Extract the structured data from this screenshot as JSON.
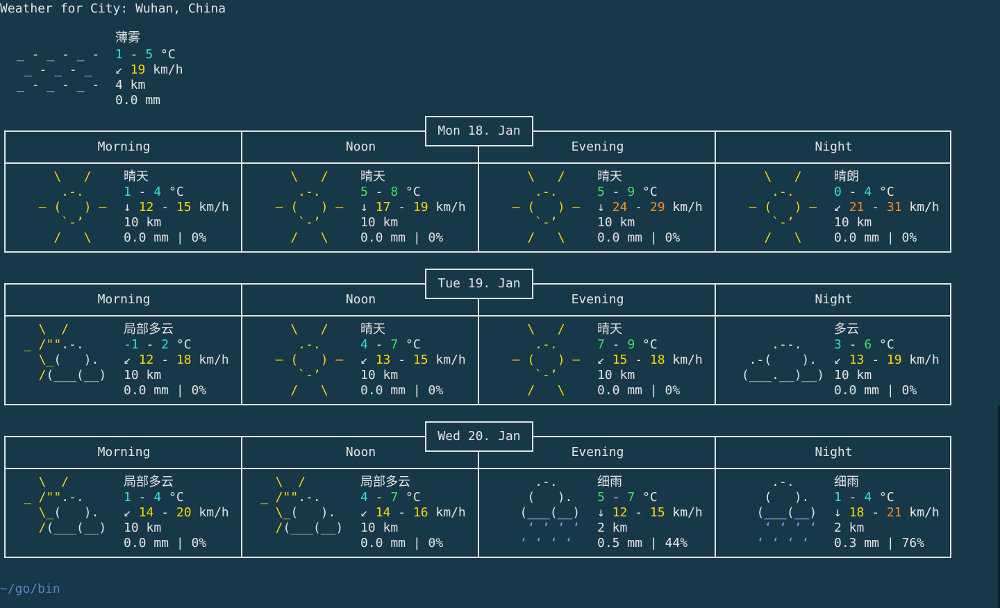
{
  "title": "Weather for City: Wuhan, China",
  "current": {
    "art": [
      "_ - _ - _ -",
      " _ - _ - _",
      "_ - _ - _ -"
    ],
    "desc": "薄雾",
    "temp_lo": "1",
    "temp_hi": "5",
    "temp_unit": "°C",
    "wind_arrow": "↙",
    "wind": "19",
    "wind_unit": "km/h",
    "visibility": "4 km",
    "rain": "0.0 mm"
  },
  "period_labels": [
    "Morning",
    "Noon",
    "Evening",
    "Night"
  ],
  "days": [
    {
      "date": "Mon 18. Jan",
      "periods": [
        {
          "icon": "sunny",
          "desc": "晴天",
          "t1": "1",
          "t2": "4",
          "unit": "°C",
          "arrow": "↓",
          "w1": "12",
          "w2": "15",
          "wunit": "km/h",
          "vis": "10 km",
          "rain": "0.0 mm | 0%"
        },
        {
          "icon": "sunny",
          "desc": "晴天",
          "t1": "5",
          "t2": "8",
          "unit": "°C",
          "arrow": "↓",
          "w1": "17",
          "w2": "19",
          "wunit": "km/h",
          "vis": "10 km",
          "rain": "0.0 mm | 0%"
        },
        {
          "icon": "sunny",
          "desc": "晴天",
          "t1": "5",
          "t2": "9",
          "unit": "°C",
          "arrow": "↓",
          "w1": "24",
          "w2": "29",
          "wunit": "km/h",
          "vis": "10 km",
          "rain": "0.0 mm | 0%"
        },
        {
          "icon": "sunny",
          "desc": "晴朗",
          "t1": "0",
          "t2": "4",
          "unit": "°C",
          "arrow": "↙",
          "w1": "21",
          "w2": "31",
          "wunit": "km/h",
          "vis": "10 km",
          "rain": "0.0 mm | 0%"
        }
      ]
    },
    {
      "date": "Tue 19. Jan",
      "periods": [
        {
          "icon": "partly",
          "desc": "局部多云",
          "t1": "-1",
          "t2": "2",
          "unit": "°C",
          "arrow": "↙",
          "w1": "12",
          "w2": "18",
          "wunit": "km/h",
          "vis": "10 km",
          "rain": "0.0 mm | 0%"
        },
        {
          "icon": "sunny",
          "desc": "晴天",
          "t1": "4",
          "t2": "7",
          "unit": "°C",
          "arrow": "↙",
          "w1": "13",
          "w2": "15",
          "wunit": "km/h",
          "vis": "10 km",
          "rain": "0.0 mm | 0%"
        },
        {
          "icon": "sunny",
          "desc": "晴天",
          "t1": "7",
          "t2": "9",
          "unit": "°C",
          "arrow": "↙",
          "w1": "15",
          "w2": "18",
          "wunit": "km/h",
          "vis": "10 km",
          "rain": "0.0 mm | 0%"
        },
        {
          "icon": "cloudy",
          "desc": "多云",
          "t1": "3",
          "t2": "6",
          "unit": "°C",
          "arrow": "↙",
          "w1": "13",
          "w2": "19",
          "wunit": "km/h",
          "vis": "10 km",
          "rain": "0.0 mm | 0%"
        }
      ]
    },
    {
      "date": "Wed 20. Jan",
      "periods": [
        {
          "icon": "partly",
          "desc": "局部多云",
          "t1": "1",
          "t2": "4",
          "unit": "°C",
          "arrow": "↙",
          "w1": "14",
          "w2": "20",
          "wunit": "km/h",
          "vis": "10 km",
          "rain": "0.0 mm | 0%"
        },
        {
          "icon": "partly",
          "desc": "局部多云",
          "t1": "4",
          "t2": "7",
          "unit": "°C",
          "arrow": "↙",
          "w1": "14",
          "w2": "16",
          "wunit": "km/h",
          "vis": "10 km",
          "rain": "0.0 mm | 0%"
        },
        {
          "icon": "rain",
          "desc": "细雨",
          "t1": "5",
          "t2": "7",
          "unit": "°C",
          "arrow": "↓",
          "w1": "12",
          "w2": "15",
          "wunit": "km/h",
          "vis": "2 km",
          "rain": "0.5 mm | 44%"
        },
        {
          "icon": "rain",
          "desc": "细雨",
          "t1": "1",
          "t2": "4",
          "unit": "°C",
          "arrow": "↓",
          "w1": "18",
          "w2": "21",
          "wunit": "km/h",
          "vis": "2 km",
          "rain": "0.3 mm | 76%"
        }
      ]
    }
  ],
  "prompt": "~/go/bin",
  "colors": {
    "background": "#173849",
    "text": "#e4e4e4",
    "sun": "#ffd800",
    "temp_cool": "#33e0d8",
    "temp_mild": "#44dd66",
    "warm": "#ffd800",
    "hot": "#ff8a1e",
    "rain": "#6aa6ff",
    "prompt": "#5f7fc8"
  }
}
